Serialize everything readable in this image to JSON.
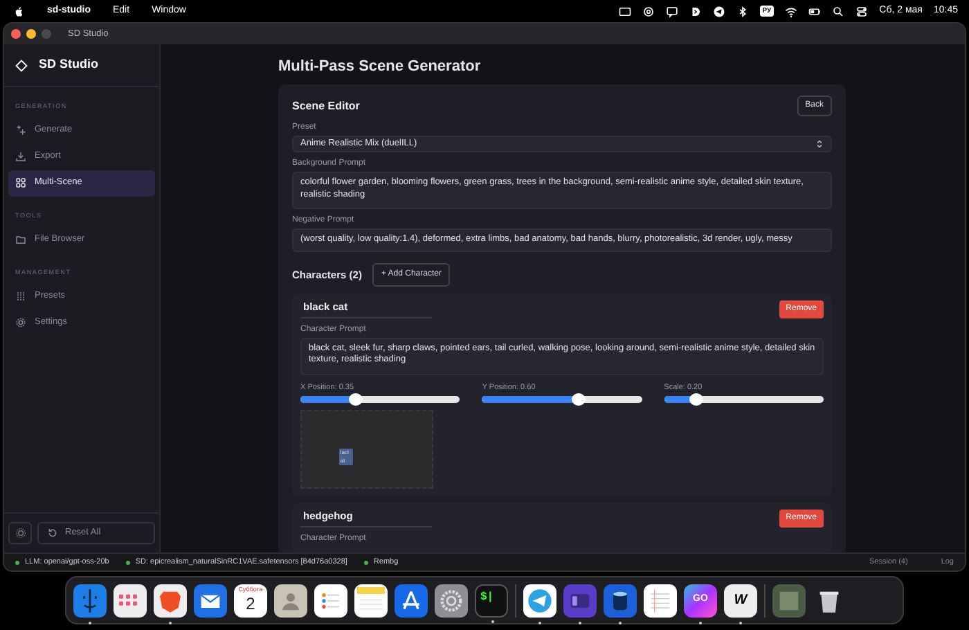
{
  "menu_bar": {
    "app": "sd-studio",
    "menus": [
      "Edit",
      "Window"
    ],
    "keyboard_layout": "РУ",
    "date": "Сб, 2 мая",
    "time": "10:45"
  },
  "window": {
    "title": "SD Studio"
  },
  "sidebar": {
    "logo": "SD Studio",
    "sections": [
      {
        "heading": "GENERATION",
        "items": [
          {
            "label": "Generate",
            "selected": false
          },
          {
            "label": "Export",
            "selected": false
          },
          {
            "label": "Multi-Scene",
            "selected": true
          }
        ]
      },
      {
        "heading": "TOOLS",
        "items": [
          {
            "label": "File Browser",
            "selected": false
          }
        ]
      },
      {
        "heading": "MANAGEMENT",
        "items": [
          {
            "label": "Presets",
            "selected": false
          },
          {
            "label": "Settings",
            "selected": false
          }
        ]
      }
    ],
    "reset_button": "Reset All"
  },
  "main": {
    "title": "Multi-Pass Scene Generator",
    "editor": {
      "title": "Scene Editor",
      "back_button": "Back",
      "preset": {
        "label": "Preset",
        "value": "Anime Realistic Mix (duelILL)"
      },
      "background_prompt": {
        "label": "Background Prompt",
        "value": "colorful flower garden, blooming flowers, green grass, trees in the background, semi-realistic anime style, detailed skin texture, realistic shading"
      },
      "negative_prompt": {
        "label": "Negative Prompt",
        "value": "(worst quality, low quality:1.4), deformed, extra limbs, bad anatomy, bad hands, blurry, photorealistic, 3d render, ugly, messy"
      },
      "characters_heading": "Characters (2)",
      "add_button": "+ Add Character",
      "characters": [
        {
          "name": "black cat",
          "remove_button": "Remove",
          "prompt_label": "Character Prompt",
          "prompt": "black cat, sleek fur, sharp claws, pointed ears, tail curled, walking pose, looking around, semi-realistic anime style, detailed skin texture, realistic shading",
          "sliders": [
            {
              "label": "X Position: 0.35",
              "level": 0.35
            },
            {
              "label": "Y Position: 0.60",
              "level": 0.6
            },
            {
              "label": "Scale: 0.20",
              "level": 0.2
            }
          ],
          "preview_marker": "lacl at"
        },
        {
          "name": "hedgehog",
          "remove_button": "Remove",
          "prompt_label": "Character Prompt"
        }
      ]
    }
  },
  "status_bar": {
    "items": [
      "LLM: openai/gpt-oss-20b",
      "SD: epicrealism_naturalSinRC1VAE.safetensors [84d76a0328]",
      "Rembg"
    ],
    "session": "Session (4)",
    "log": "Log"
  },
  "dock": {
    "apps": [
      {
        "kind": "finder",
        "running": true
      },
      {
        "kind": "launchpad",
        "running": false
      },
      {
        "kind": "brave",
        "running": true
      },
      {
        "kind": "mail",
        "running": false
      },
      {
        "kind": "calendar",
        "label": "Суббота",
        "day": "2",
        "running": false
      },
      {
        "kind": "contacts",
        "running": false
      },
      {
        "kind": "reminders",
        "running": false
      },
      {
        "kind": "notes",
        "running": false
      },
      {
        "kind": "appstore",
        "running": false
      },
      {
        "kind": "settings",
        "running": false
      },
      {
        "kind": "terminal",
        "label": "$|",
        "running": true
      },
      {
        "kind": "separator"
      },
      {
        "kind": "telegram",
        "running": true
      },
      {
        "kind": "purple",
        "running": true
      },
      {
        "kind": "database",
        "running": true
      },
      {
        "kind": "textedit",
        "running": false
      },
      {
        "kind": "goland",
        "label": "GO",
        "running": true
      },
      {
        "kind": "webstorm",
        "label": "W",
        "running": true
      },
      {
        "kind": "separator"
      },
      {
        "kind": "photo",
        "running": false
      },
      {
        "kind": "trash",
        "running": false
      }
    ]
  }
}
